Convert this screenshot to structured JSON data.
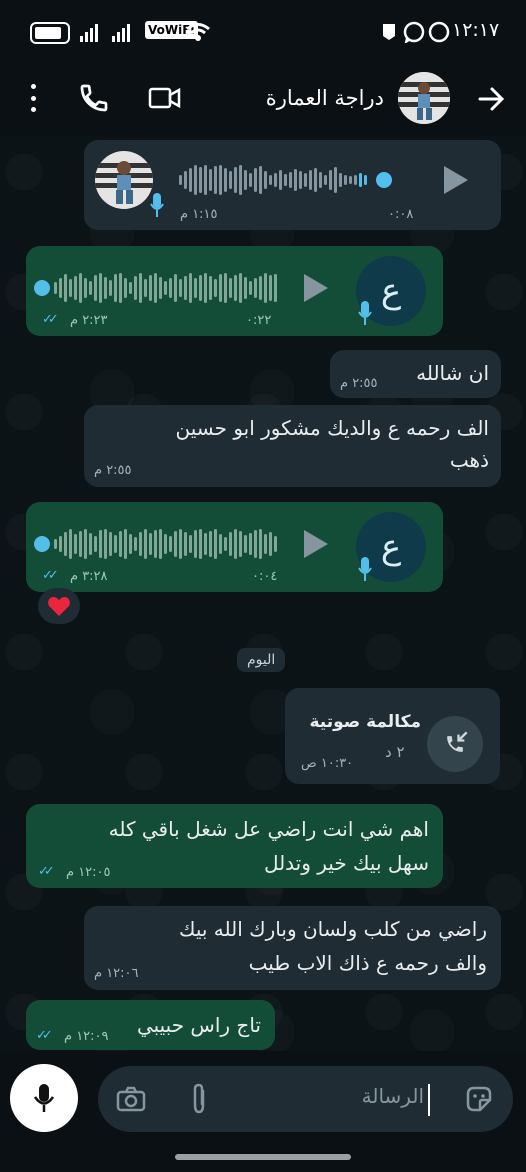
{
  "status_bar": {
    "time": "١٢:١٧",
    "vowifi": "VoWiFi"
  },
  "header": {
    "contact_name": "دراجة العمارة"
  },
  "messages": {
    "voice1": {
      "duration": "٠:٠٨",
      "time": "١:١٥ م"
    },
    "voice2": {
      "avatar_letter": "ع",
      "duration": "٠:٢٢",
      "time": "٢:٢٣ م"
    },
    "text1": {
      "text": "ان شالله",
      "time": "٢:٥٥ م"
    },
    "text2": {
      "line1": "الف رحمه ع والديك مشكور ابو حسين",
      "line2": "ذهب",
      "time": "٢:٥٥ م"
    },
    "voice3": {
      "avatar_letter": "ع",
      "duration": "٠:٠٤",
      "time": "٣:٢٨ م",
      "reaction": "❤️"
    },
    "date_divider": "اليوم",
    "call": {
      "title": "مكالمة صوتية",
      "duration": "٢ د",
      "time": "١٠:٣٠ ص"
    },
    "text3": {
      "line1": "اهم شي انت راضي عل شغل باقي كله",
      "line2": "سهل بيك خير وتدلل",
      "time": "١٢:٠٥ م"
    },
    "text4": {
      "line1": "راضي من كلب ولسان وبارك الله بيك",
      "line2": "والف رحمه ع ذاك الاب طيب",
      "time": "١٢:٠٦ م"
    },
    "text5": {
      "text": "تاج راس حبيبي",
      "time": "١٢:٠٩ م"
    }
  },
  "input": {
    "placeholder": "الرسالة"
  },
  "colors": {
    "outgoing_bubble": "#144d37",
    "incoming_bubble": "#1f2c33",
    "accent_blue": "#53bdeb",
    "mic_button": "#ffffff"
  },
  "icons": [
    "back-arrow-icon",
    "phone-icon",
    "video-icon",
    "more-icon",
    "play-icon",
    "mic-icon",
    "camera-icon",
    "attach-icon",
    "sticker-icon",
    "call-incoming-icon"
  ]
}
